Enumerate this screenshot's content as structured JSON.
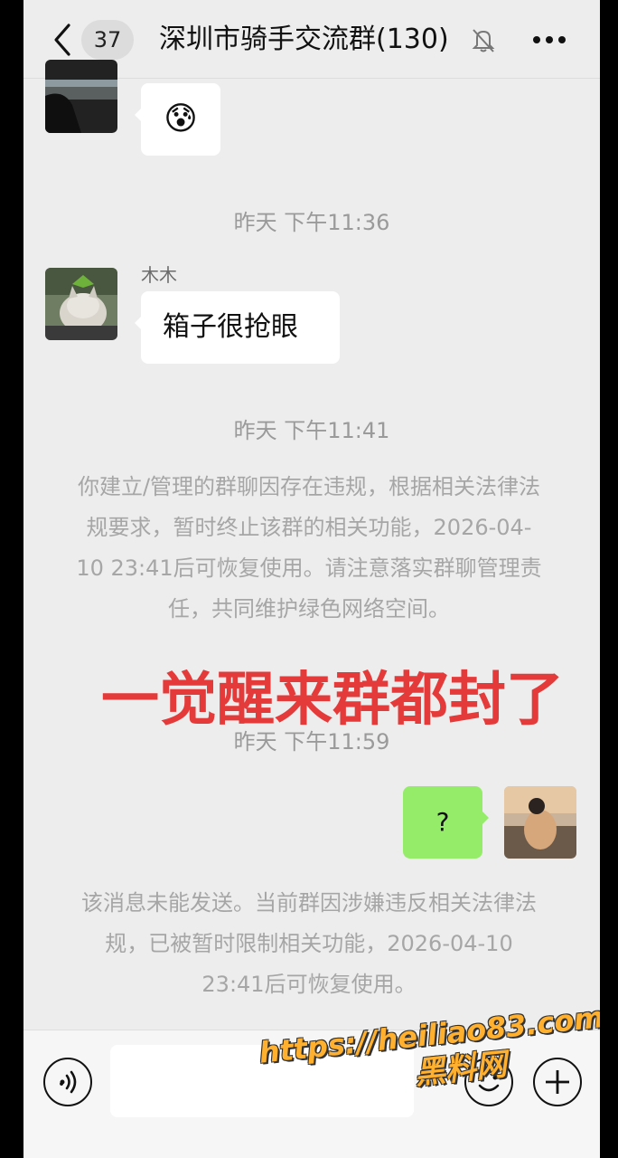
{
  "header": {
    "back_label": "<",
    "unread_count": "37",
    "title": "深圳市骑手交流群(130)",
    "mute_icon": "bell-off-icon",
    "more_icon": "more-dots-icon"
  },
  "messages": {
    "first_emoji": "😰",
    "time_1": "昨天 下午11:36",
    "sender_2": "木木",
    "text_2": "箱子很抢眼",
    "time_2": "昨天 下午11:41",
    "system_1": "你建立/管理的群聊因存在违规，根据相关法律法规要求，暂时终止该群的相关功能，2026-04-10 23:41后可恢复使用。请注意落实群聊管理责任，共同维护绿色网络空间。",
    "time_3": "昨天 下午11:59",
    "own_text": "?",
    "system_2": "该消息未能发送。当前群因涉嫌违反相关法律法规，已被暂时限制相关功能，2026-04-10 23:41后可恢复使用。"
  },
  "overlay_caption": "一觉醒来群都封了",
  "watermark": {
    "url": "https://heiliao83.com",
    "name": "黑料网"
  },
  "inputbar": {
    "voice_icon": "voice-icon",
    "emoji_icon": "emoji-icon",
    "plus_icon": "plus-icon"
  },
  "colors": {
    "own_bubble": "#95ec69",
    "overlay_text": "#e53a3a",
    "watermark": "#ffb02e"
  }
}
